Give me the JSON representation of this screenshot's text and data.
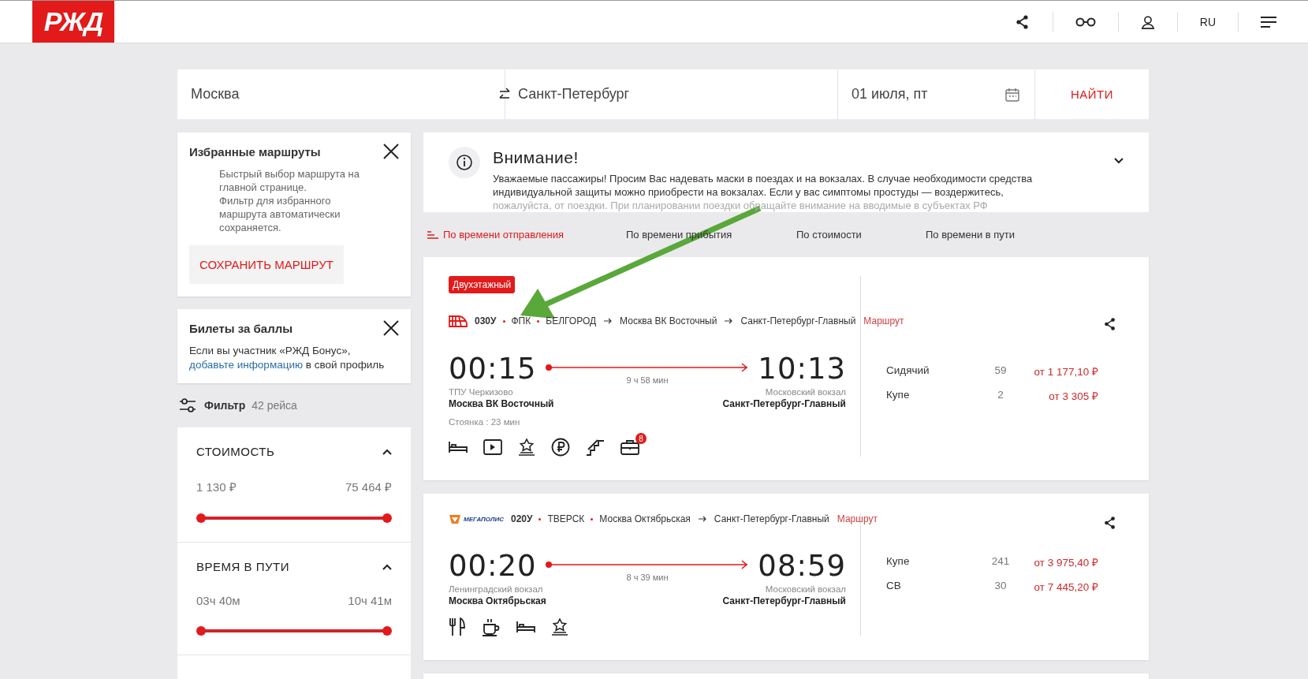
{
  "header": {
    "logo": "РЖД",
    "language": "RU"
  },
  "search": {
    "from": "Москва",
    "to": "Санкт-Петербург",
    "date": "01 июля, пт",
    "button": "НАЙТИ"
  },
  "favorites": {
    "title": "Избранные маршруты",
    "lines": [
      "Быстрый выбор маршрута на главной странице.",
      "Фильтр для избранного маршрута автоматически сохраняется."
    ],
    "button": "СОХРАНИТЬ МАРШРУТ"
  },
  "bonus": {
    "title": "Билеты за баллы",
    "text": "Если вы участник «РЖД Бонус»,",
    "link": "добавьте информацию",
    "tail": "в свой профиль"
  },
  "filter": {
    "label": "Фильтр",
    "count": "42 рейса"
  },
  "ranges": [
    {
      "title": "СТОИМОСТЬ",
      "expanded": true,
      "min": "1 130 ₽",
      "max": "75 464 ₽",
      "level": 1
    },
    {
      "title": "ВРЕМЯ В ПУТИ",
      "expanded": true,
      "min": "03ч 40м",
      "max": "10ч 41м",
      "level": 1
    }
  ],
  "notice": {
    "title": "Внимание!",
    "expanded": false,
    "text": "Уважаемые пассажиры! Просим Вас надевать маски в поездах и на вокзалах. В случае необходимости средства индивидуальной защиты можно приобрести на вокзалах. Если у вас симптомы простуды — воздержитесь,",
    "faded": "пожалуйста, от поездки. При планировании поездки обращайте внимание на вводимые в субъектах РФ"
  },
  "sort": [
    {
      "label": "По времени отправления",
      "selected": true
    },
    {
      "label": "По времени прибытия",
      "selected": false
    },
    {
      "label": "По стоимости",
      "selected": false
    },
    {
      "label": "По времени в пути",
      "selected": false
    }
  ],
  "trains": [
    {
      "badge": "Двухэтажный",
      "logo": {
        "kind": "train"
      },
      "number": "030У",
      "carrier": "ФПК",
      "points": [
        "БЕЛГОРОД",
        "Москва ВК Восточный",
        "Санкт-Петербург-Главный"
      ],
      "route_link": "Маршрут",
      "dep_time": "00:15",
      "arr_time": "10:13",
      "duration": "9 ч 58 мин",
      "dep_station": "ТПУ Черкизово",
      "dep_city": "Москва ВК Восточный",
      "arr_station": "Московский вокзал",
      "arr_city": "Санкт-Петербург-Главный",
      "stop": "Стоянка : 23 мин",
      "amenities": [
        {
          "kind": "bed"
        },
        {
          "kind": "video"
        },
        {
          "kind": "award"
        },
        {
          "kind": "ruble"
        },
        {
          "kind": "stairs"
        },
        {
          "kind": "luggage",
          "count": "8"
        }
      ],
      "classes": [
        {
          "name": "Сидячий",
          "seats": "59",
          "price": "от 1 177,10 ₽"
        },
        {
          "name": "Купе",
          "seats": "2",
          "price": "от 3 305 ₽"
        }
      ]
    },
    {
      "logo": {
        "kind": "brand",
        "text": "МЕГАПОЛИС"
      },
      "number": "020У",
      "carrier": "ТВЕРСК",
      "points": [
        "Москва Октябрьская",
        "Санкт-Петербург-Главный"
      ],
      "route_link": "Маршрут",
      "dep_time": "00:20",
      "arr_time": "08:59",
      "duration": "8 ч 39 мин",
      "dep_station": "Ленинградский вокзал",
      "dep_city": "Москва Октябрьская",
      "arr_station": "Московский вокзал",
      "arr_city": "Санкт-Петербург-Главный",
      "amenities": [
        {
          "kind": "food"
        },
        {
          "kind": "coffee"
        },
        {
          "kind": "bed"
        },
        {
          "kind": "award"
        }
      ],
      "classes": [
        {
          "name": "Купе",
          "seats": "241",
          "price": "от 3 975,40 ₽"
        },
        {
          "name": "СВ",
          "seats": "30",
          "price": "от 7 445,20 ₽"
        }
      ]
    }
  ]
}
